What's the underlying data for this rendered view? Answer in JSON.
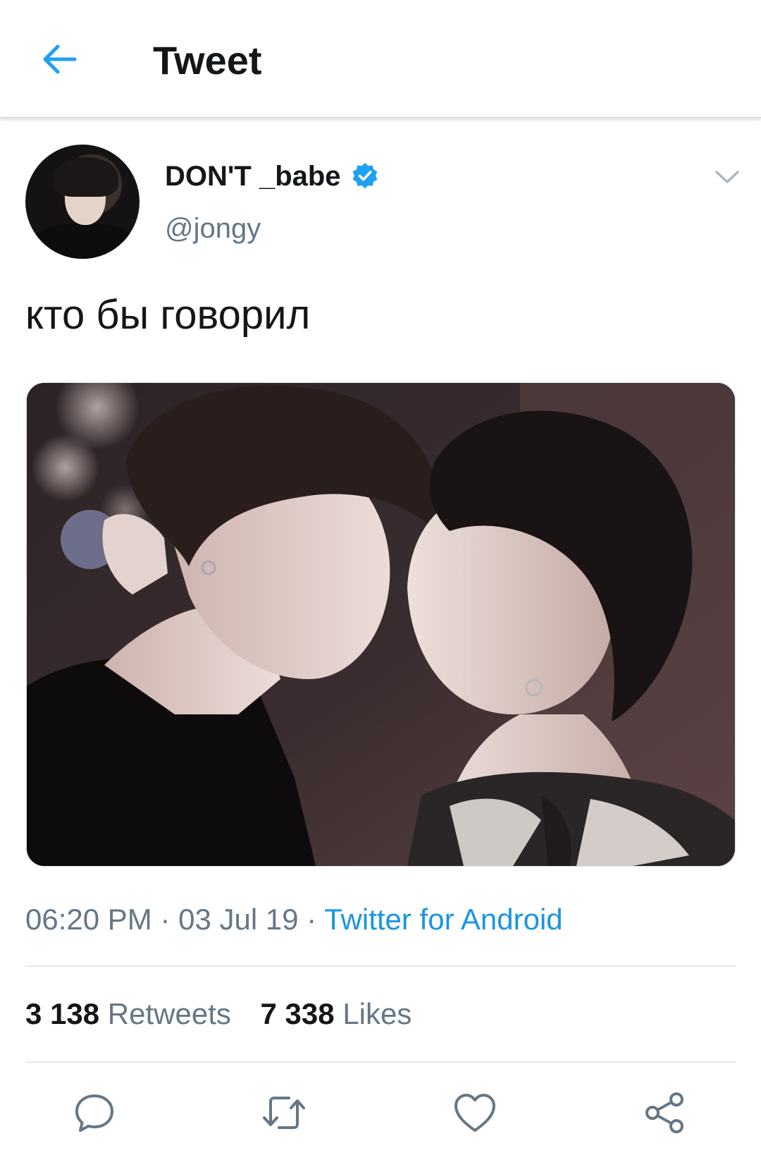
{
  "header": {
    "title": "Tweet",
    "back_icon": "arrow-left-icon",
    "accent_color": "#1da1f2"
  },
  "tweet": {
    "author_name": "DON'T _babe",
    "author_handle": "@jongy",
    "verified": true,
    "text": "кто бы говорил",
    "time": "06:20 PM",
    "date": "03 Jul 19",
    "separator": "·",
    "source": "Twitter for Android",
    "retweets_count": "3 138",
    "retweets_label": "Retweets",
    "likes_count": "7 338",
    "likes_label": "Likes"
  },
  "actions": [
    {
      "icon": "reply-icon"
    },
    {
      "icon": "retweet-icon"
    },
    {
      "icon": "like-icon"
    },
    {
      "icon": "share-icon"
    }
  ],
  "colors": {
    "text": "#14171a",
    "secondary": "#657786",
    "link": "#1b95e0",
    "verified": "#1da1f2"
  }
}
